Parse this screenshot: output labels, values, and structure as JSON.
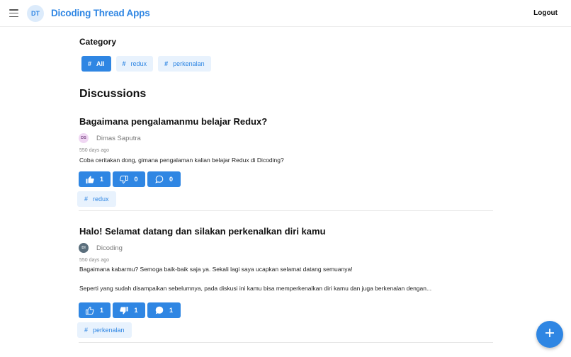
{
  "header": {
    "avatar_initials": "DT",
    "title": "Dicoding Thread Apps",
    "logout_label": "Logout",
    "menu_icon": "hamburger-menu-icon"
  },
  "category": {
    "title": "Category",
    "chips": [
      {
        "label": "All",
        "active": true
      },
      {
        "label": "redux",
        "active": false
      },
      {
        "label": "perkenalan",
        "active": false
      }
    ]
  },
  "discussions": {
    "title": "Discussions",
    "threads": [
      {
        "title": "Bagaimana pengalamanmu belajar Redux?",
        "owner": {
          "initials": "DS",
          "name": "Dimas Saputra"
        },
        "time": "550 days ago",
        "body": "Coba ceritakan dong, gimana pengalaman kalian belajar Redux di Dicoding?",
        "upvotes": "1",
        "downvotes": "0",
        "comments": "0",
        "upvoted": true,
        "downvoted": false,
        "category": "redux"
      },
      {
        "title": "Halo! Selamat datang dan silakan perkenalkan diri kamu",
        "owner": {
          "initials": "DI",
          "name": "Dicoding"
        },
        "time": "550 days ago",
        "body": "Bagaimana kabarmu? Semoga baik-baik saja ya. Sekali lagi saya ucapkan selamat datang semuanya!\n\nSeperti yang sudah disampaikan sebelumnya, pada diskusi ini kamu bisa memperkenalkan diri kamu dan juga berkenalan dengan...",
        "upvotes": "1",
        "downvotes": "1",
        "comments": "1",
        "upvoted": false,
        "downvoted": true,
        "category": "perkenalan"
      }
    ]
  },
  "fab": {
    "icon": "plus-icon"
  },
  "colors": {
    "accent": "#2f86e3",
    "chip_bg": "#e8f2fd",
    "avatar_ds_bg": "#f0d7f3",
    "avatar_di_bg": "#5a6e7c"
  }
}
